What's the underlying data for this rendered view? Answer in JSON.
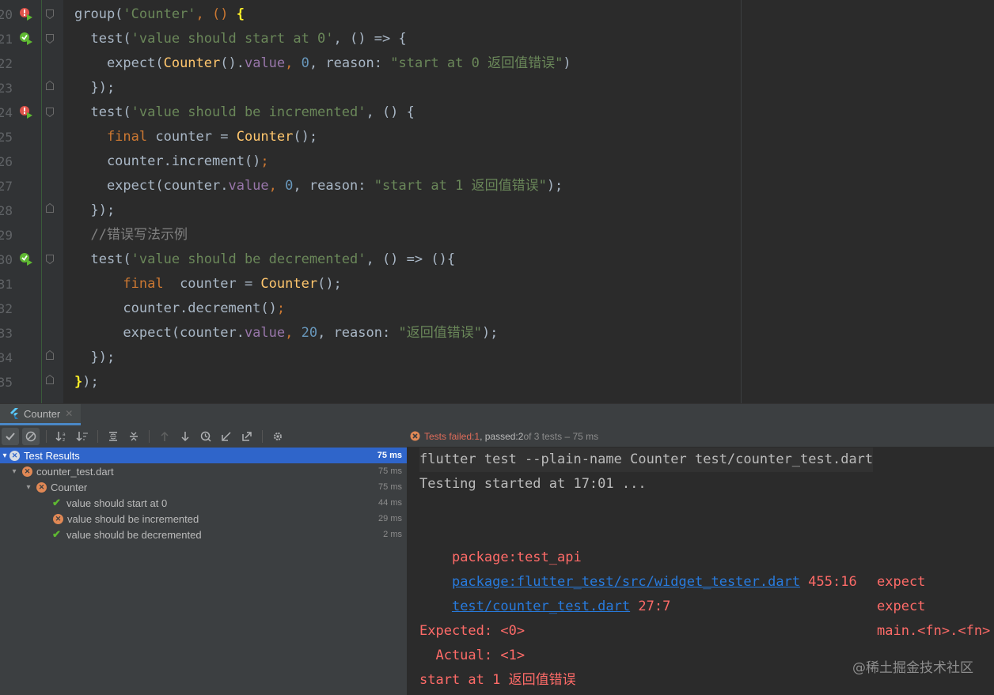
{
  "editor": {
    "line_numbers": [
      "20",
      "21",
      "22",
      "23",
      "24",
      "25",
      "26",
      "27",
      "28",
      "29",
      "30",
      "31",
      "32",
      "33",
      "34",
      "35"
    ],
    "code": {
      "l20_a": "group(",
      "l20_b": "'Counter'",
      "l20_c": ", () ",
      "l20_d": "{",
      "l21_a": "  test(",
      "l21_b": "'value should start at 0'",
      "l21_c": ", () => {",
      "l22_a": "    expect(",
      "l22_b": "Counter",
      "l22_c": "().",
      "l22_d": "value",
      "l22_e": ", ",
      "l22_f": "0",
      "l22_g": ", reason: ",
      "l22_h": "\"start at 0 返回值错误\"",
      "l22_i": ")",
      "l23": "  });",
      "l24_a": "  test(",
      "l24_b": "'value should be incremented'",
      "l24_c": ", () {",
      "l25_a": "    final",
      "l25_b": " counter = ",
      "l25_c": "Counter",
      "l25_d": "();",
      "l26_a": "    counter.increment()",
      "l26_b": ";",
      "l27_a": "    expect(counter.",
      "l27_b": "value",
      "l27_c": ", ",
      "l27_d": "0",
      "l27_e": ", reason: ",
      "l27_f": "\"start at 1 返回值错误\"",
      "l27_g": ");",
      "l28": "  });",
      "l29": "  //错误写法示例",
      "l30_a": "  test(",
      "l30_b": "'value should be decremented'",
      "l30_c": ", () => (){",
      "l31_a": "      final",
      "l31_b": "  counter = ",
      "l31_c": "Counter",
      "l31_d": "();",
      "l32_a": "      counter.decrement()",
      "l32_b": ";",
      "l33_a": "      expect(counter.",
      "l33_b": "value",
      "l33_c": ", ",
      "l33_d": "20",
      "l33_e": ", reason: ",
      "l33_f": "\"返回值错误\"",
      "l33_g": ");",
      "l34": "  });",
      "l35_a": "}",
      "l35_b": ");"
    }
  },
  "tool_window": {
    "tab_label": "Counter",
    "close_glyph": "✕"
  },
  "status": {
    "failed_label": "Tests failed: ",
    "failed_count": "1",
    "passed_label": ", passed: ",
    "passed_count": "2",
    "of_label": " of 3 tests – 75 ms"
  },
  "tree": {
    "root": {
      "label": "Test Results",
      "duration": "75 ms"
    },
    "file": {
      "label": "counter_test.dart",
      "duration": "75 ms"
    },
    "group": {
      "label": "Counter",
      "duration": "75 ms"
    },
    "tests": [
      {
        "label": "value should start at 0",
        "duration": "44 ms",
        "status": "passed"
      },
      {
        "label": "value should be incremented",
        "duration": "29 ms",
        "status": "failed"
      },
      {
        "label": "value should be decremented",
        "duration": "2 ms",
        "status": "passed"
      }
    ]
  },
  "console": {
    "command": "flutter test --plain-name Counter test/counter_test.dart",
    "started": "Testing started at 17:01 ...",
    "stack": [
      {
        "loc": "package:test_api",
        "pos": "",
        "fn": "expect"
      },
      {
        "loc": "package:flutter_test/src/widget_tester.dart",
        "pos": " 455:16",
        "fn": "expect"
      },
      {
        "loc": "test/counter_test.dart",
        "pos": " 27:7",
        "fn": "main.<fn>.<fn>"
      }
    ],
    "expected": "Expected: <0>",
    "actual": "  Actual: <1>",
    "reason": "start at 1 返回值错误"
  },
  "watermark": "@稀土掘金技术社区",
  "colors": {
    "keyword": "#cc7832",
    "string": "#6a8759",
    "number": "#6897bb",
    "class": "#ffc66d",
    "property": "#9876aa",
    "error": "#ff6b68",
    "link": "#287bde",
    "selection": "#2f65ca",
    "pass": "#5fb832",
    "fail": "#e08855"
  }
}
